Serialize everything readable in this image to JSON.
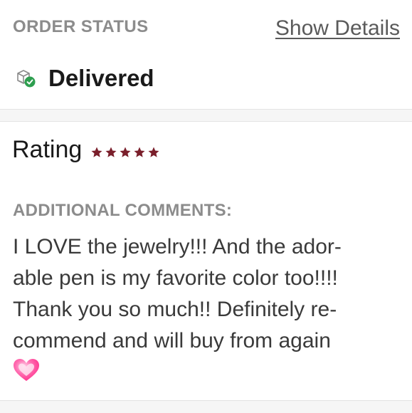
{
  "order_status": {
    "label": "ORDER STATUS",
    "details_link": "Show Details",
    "status_icon": "delivered-box-check-icon",
    "status_text": "Delivered",
    "status_color": "#2e9e4f"
  },
  "review": {
    "rating_label": "Rating",
    "rating_value": 5,
    "rating_max": 5,
    "star_color": "#7a1f2b",
    "comments_label": "ADDITIONAL COMMENTS:",
    "comment_text": "I LOVE the jewelry!!! And the ador-\nable pen is my favorite color too!!!!\nThank you so much!! Definitely re-\ncommend and will buy from again",
    "comment_emoji": "pink-heart-icon"
  }
}
